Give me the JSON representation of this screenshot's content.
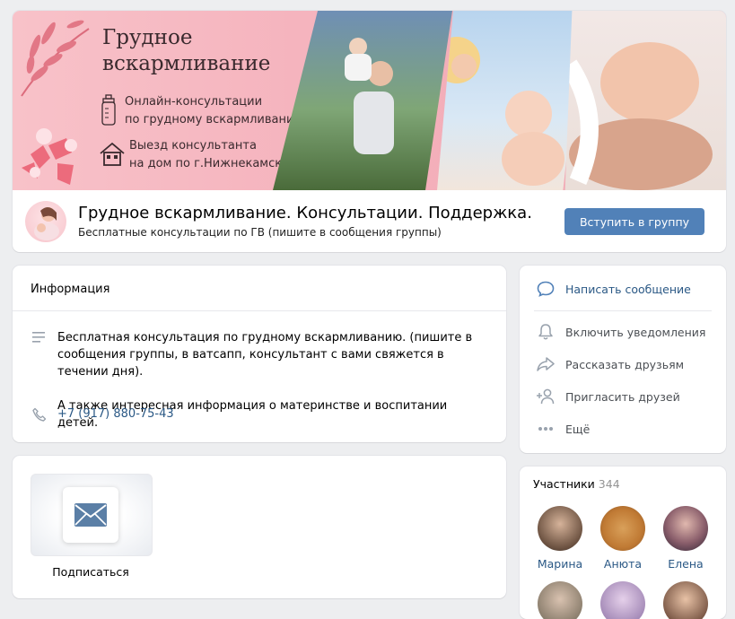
{
  "cover": {
    "title_line1": "Грудное",
    "title_line2": "вскармливание",
    "line1a": "Онлайн-консультации",
    "line1b": "по грудному вскармливанию",
    "line2a": "Выезд консультанта",
    "line2b": "на дом по г.Нижнекамску"
  },
  "group": {
    "title": "Грудное вскармливание. Консультации. Поддержка.",
    "status": "Бесплатные консультации по ГВ (пишите в сообщения группы)",
    "join_label": "Вступить в группу"
  },
  "info": {
    "header": "Информация",
    "description_1": "Бесплатная консультация по грудному вскармливанию. (пишите в сообщения группы, в ватсапп, консультант с вами свяжется в течении дня).",
    "description_2": "А также интересная информация о материнстве и воспитании детей.",
    "phone": "+7 (917) 880-75-43"
  },
  "subscribe": {
    "label": "Подписаться"
  },
  "actions": {
    "items": [
      {
        "label": "Написать сообщение",
        "icon": "message-icon"
      },
      {
        "label": "Включить уведомления",
        "icon": "bell-icon"
      },
      {
        "label": "Рассказать друзьям",
        "icon": "share-icon"
      },
      {
        "label": "Пригласить друзей",
        "icon": "add-user-icon"
      },
      {
        "label": "Ещё",
        "icon": "more-icon"
      }
    ]
  },
  "members": {
    "title": "Участники",
    "count": "344",
    "list": [
      {
        "name": "Марина"
      },
      {
        "name": "Анюта"
      },
      {
        "name": "Елена"
      }
    ]
  },
  "colors": {
    "accent": "#5181b8",
    "link": "#2a5885",
    "background": "#edeef0",
    "cover_pink": "#f5b4be"
  }
}
